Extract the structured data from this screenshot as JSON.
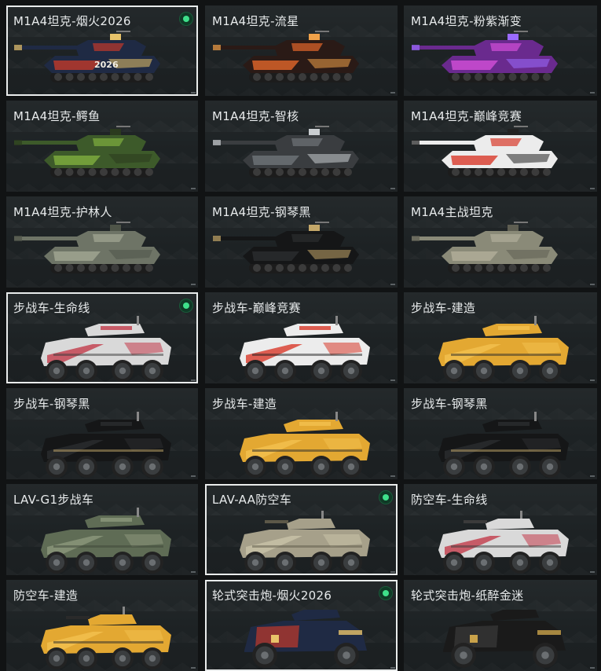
{
  "skins": [
    {
      "title": "M1A4坦克-烟火2026",
      "kind": "tank",
      "scheme": "fireworks",
      "equipped": true,
      "selected": true,
      "decal": "2026"
    },
    {
      "title": "M1A4坦克-流星",
      "kind": "tank",
      "scheme": "meteor",
      "equipped": false,
      "selected": false
    },
    {
      "title": "M1A4坦克-粉紫渐变",
      "kind": "tank",
      "scheme": "purple",
      "equipped": false,
      "selected": false
    },
    {
      "title": "M1A4坦克-鳄鱼",
      "kind": "tank",
      "scheme": "crocodile",
      "equipped": false,
      "selected": false
    },
    {
      "title": "M1A4坦克-智核",
      "kind": "tank",
      "scheme": "core",
      "equipped": false,
      "selected": false
    },
    {
      "title": "M1A4坦克-巅峰竞赛",
      "kind": "tank",
      "scheme": "race",
      "equipped": false,
      "selected": false
    },
    {
      "title": "M1A4坦克-护林人",
      "kind": "tank",
      "scheme": "ranger",
      "equipped": false,
      "selected": false
    },
    {
      "title": "M1A4坦克-钢琴黑",
      "kind": "tank",
      "scheme": "piano",
      "equipped": false,
      "selected": false
    },
    {
      "title": "M1A4主战坦克",
      "kind": "tank",
      "scheme": "default",
      "equipped": false,
      "selected": false
    },
    {
      "title": "步战车-生命线",
      "kind": "ifv",
      "scheme": "lifeline",
      "equipped": true,
      "selected": true
    },
    {
      "title": "步战车-巅峰竞赛",
      "kind": "ifv",
      "scheme": "race",
      "equipped": false,
      "selected": false
    },
    {
      "title": "步战车-建造",
      "kind": "ifv",
      "scheme": "build",
      "equipped": false,
      "selected": false
    },
    {
      "title": "步战车-钢琴黑",
      "kind": "ifv",
      "scheme": "piano",
      "equipped": false,
      "selected": false
    },
    {
      "title": "步战车-建造",
      "kind": "ifv",
      "scheme": "build",
      "equipped": false,
      "selected": false
    },
    {
      "title": "步战车-钢琴黑",
      "kind": "ifv",
      "scheme": "piano",
      "equipped": false,
      "selected": false
    },
    {
      "title": "LAV-G1步战车",
      "kind": "ifv",
      "scheme": "green",
      "equipped": false,
      "selected": false
    },
    {
      "title": "LAV-AA防空车",
      "kind": "aa",
      "scheme": "tan",
      "equipped": true,
      "selected": true
    },
    {
      "title": "防空车-生命线",
      "kind": "aa",
      "scheme": "lifeline",
      "equipped": false,
      "selected": false
    },
    {
      "title": "防空车-建造",
      "kind": "aa",
      "scheme": "build",
      "equipped": false,
      "selected": false
    },
    {
      "title": "轮式突击炮-烟火2026",
      "kind": "assault",
      "scheme": "fireworks",
      "equipped": true,
      "selected": true
    },
    {
      "title": "轮式突击炮-纸醉金迷",
      "kind": "assault",
      "scheme": "gold",
      "equipped": false,
      "selected": false
    }
  ],
  "palettes": {
    "fireworks": {
      "body": "#1f2a44",
      "accent": "#c0392b",
      "detail": "#e8c36a"
    },
    "meteor": {
      "body": "#2a1a16",
      "accent": "#e2662b",
      "detail": "#f1a24a"
    },
    "purple": {
      "body": "#6a2a8e",
      "accent": "#d34fd8",
      "detail": "#9b6bff"
    },
    "crocodile": {
      "body": "#3d5a2a",
      "accent": "#7fae3e",
      "detail": "#2b3a1e"
    },
    "core": {
      "body": "#3a3d40",
      "accent": "#6f7478",
      "detail": "#c9cdd0"
    },
    "race": {
      "body": "#ececec",
      "accent": "#d93a2b",
      "detail": "#222222"
    },
    "ranger": {
      "body": "#6e7466",
      "accent": "#a3a894",
      "detail": "#4e5448"
    },
    "piano": {
      "body": "#151617",
      "accent": "#2b2d2f",
      "detail": "#c4a86a"
    },
    "default": {
      "body": "#8a8a78",
      "accent": "#b1ae9a",
      "detail": "#5e5e52"
    },
    "lifeline": {
      "body": "#d9d9d9",
      "accent": "#c23b4a",
      "detail": "#3b3b3b"
    },
    "build": {
      "body": "#e3a832",
      "accent": "#f2c04f",
      "detail": "#2a2a2a"
    },
    "green": {
      "body": "#5f6c55",
      "accent": "#8c987c",
      "detail": "#3e4638"
    },
    "tan": {
      "body": "#a6a08a",
      "accent": "#c9c3a8",
      "detail": "#5c5848"
    },
    "gold": {
      "body": "#1a1a1a",
      "accent": "#3a3a3a",
      "detail": "#c9a24a"
    }
  },
  "icons": {
    "equipped": "equipped-dot-icon"
  }
}
